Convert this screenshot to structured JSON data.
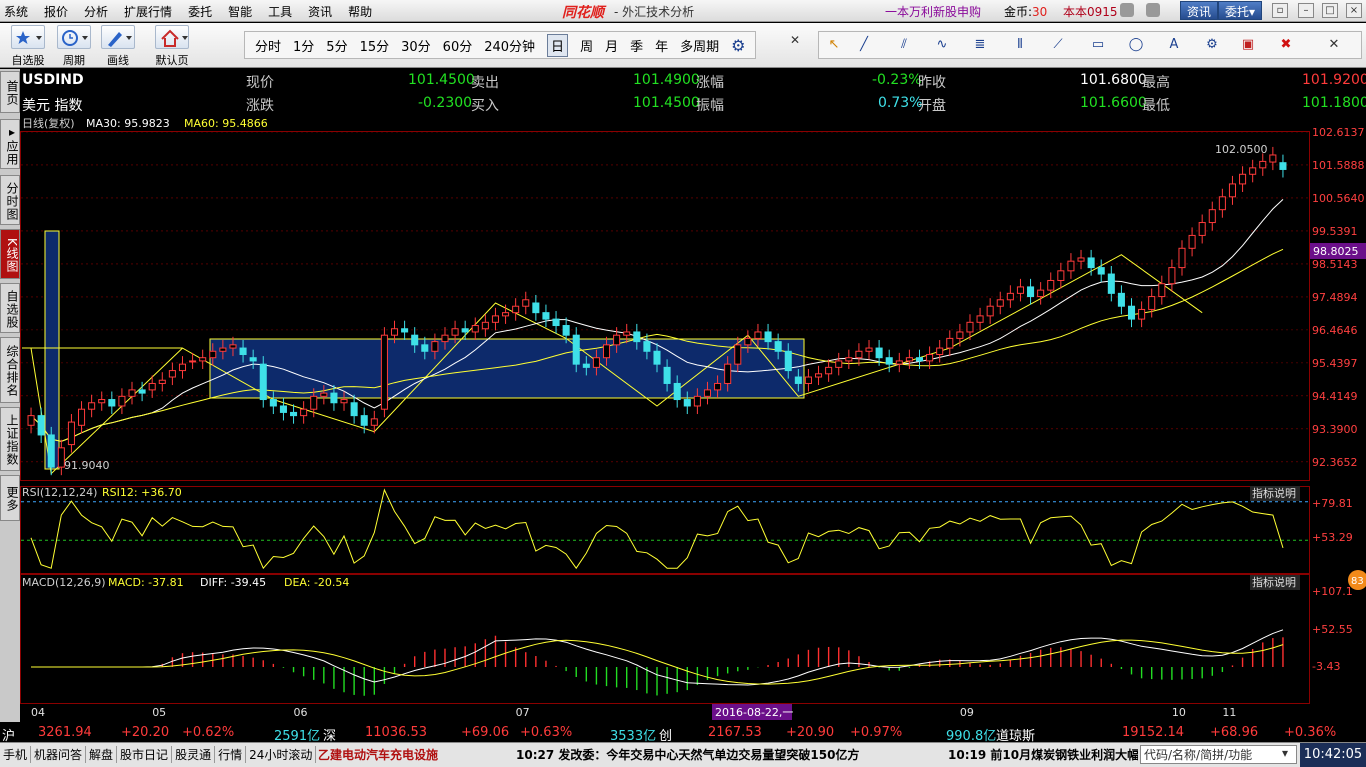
{
  "menu": {
    "items": [
      "系统",
      "报价",
      "分析",
      "扩展行情",
      "委托",
      "智能",
      "工具",
      "资讯",
      "帮助"
    ],
    "logo": "同花顺",
    "app_title": "- 外汇技术分析",
    "promo": "一本万利新股申购",
    "coins_label": "金币:",
    "coins_value": "30",
    "user": "本本0915",
    "info_button": "资讯",
    "trade_button": "委托▾"
  },
  "toolbar": {
    "groups": [
      {
        "label": "自选股",
        "icon": "star-icon"
      },
      {
        "label": "周期",
        "icon": "clock-icon"
      },
      {
        "label": "画线",
        "icon": "pen-icon"
      },
      {
        "label": "默认页",
        "icon": "home-icon"
      }
    ],
    "periods": [
      "分时",
      "1分",
      "5分",
      "15分",
      "30分",
      "60分",
      "240分钟",
      "日",
      "周",
      "月",
      "季",
      "年",
      "多周期"
    ],
    "active_period": "日"
  },
  "sidetabs": [
    {
      "label": "首页",
      "active": false
    },
    {
      "label": "▸应用",
      "active": false
    },
    {
      "label": "分时图",
      "active": false
    },
    {
      "label": "K线图",
      "active": true
    },
    {
      "label": "自选股",
      "active": false
    },
    {
      "label": "综合排名",
      "active": false
    },
    {
      "label": "上证指数",
      "active": false
    },
    {
      "label": "更多",
      "active": false
    }
  ],
  "quote": {
    "symbol": "USDIND",
    "name": "美元 指数",
    "now_label": "现价",
    "now_value": "101.4500",
    "sell_label": "卖出",
    "sell_value": "101.4900",
    "chg_pct_label": "涨幅",
    "chg_pct_value": "-0.23%",
    "prev_label": "昨收",
    "prev_value": "101.6800",
    "high_label": "最高",
    "high_value": "101.9200",
    "chg_label": "涨跌",
    "chg_value": "-0.2300",
    "buy_label": "买入",
    "buy_value": "101.4500",
    "amp_label": "振幅",
    "amp_value": "0.73%",
    "open_label": "开盘",
    "open_value": "101.6600",
    "low_label": "最低",
    "low_value": "101.1800"
  },
  "chart_data": [
    {
      "type": "candlestick",
      "legend": {
        "period": "日线(复权)",
        "ma30": "MA30: 95.9823",
        "ma60": "MA60: 95.4866"
      },
      "y_ticks": [
        "102.6137",
        "101.5888",
        "100.5640",
        "99.5391",
        "98.5143",
        "97.4894",
        "96.4646",
        "95.4397",
        "94.4149",
        "93.3900",
        "92.3652"
      ],
      "ylim": [
        91.8,
        102.6137
      ],
      "current_price_tag": "98.8025",
      "annotations": {
        "high": "102.0500",
        "low": "91.9040"
      },
      "x_labels": [
        "04",
        "05",
        "06",
        "07",
        "08",
        "09",
        "10",
        "11"
      ],
      "cursor_date": "2016-08-22,一",
      "closes": [
        93.8,
        93.2,
        92.2,
        92.8,
        93.6,
        94.0,
        94.2,
        94.3,
        94.1,
        94.4,
        94.6,
        94.5,
        94.8,
        94.9,
        95.2,
        95.4,
        95.5,
        95.6,
        95.8,
        95.9,
        96.0,
        95.7,
        95.5,
        94.3,
        94.1,
        93.9,
        93.8,
        94.0,
        94.4,
        94.5,
        94.2,
        94.3,
        93.8,
        93.5,
        93.7,
        96.3,
        96.5,
        96.4,
        96.0,
        95.8,
        96.1,
        96.3,
        96.5,
        96.4,
        96.6,
        96.7,
        96.9,
        97.0,
        97.2,
        97.4,
        97.0,
        96.8,
        96.6,
        96.3,
        95.4,
        95.3,
        95.6,
        96.0,
        96.3,
        96.4,
        96.1,
        95.8,
        95.4,
        94.8,
        94.3,
        94.1,
        94.4,
        94.6,
        94.8,
        95.4,
        96.0,
        96.2,
        96.4,
        96.1,
        95.8,
        95.2,
        94.8,
        95.0,
        95.1,
        95.3,
        95.5,
        95.6,
        95.8,
        95.9,
        95.6,
        95.4,
        95.5,
        95.6,
        95.5,
        95.7,
        95.9,
        96.2,
        96.4,
        96.7,
        96.9,
        97.2,
        97.4,
        97.6,
        97.8,
        97.5,
        97.7,
        98.0,
        98.3,
        98.6,
        98.7,
        98.4,
        98.2,
        97.6,
        97.2,
        96.8,
        97.1,
        97.5,
        97.9,
        98.4,
        99.0,
        99.4,
        99.8,
        100.2,
        100.6,
        101.0,
        101.3,
        101.5,
        101.7,
        101.9,
        101.45
      ],
      "opens": [
        93.5,
        93.8,
        93.2,
        92.2,
        92.9,
        93.5,
        94.0,
        94.2,
        94.3,
        94.1,
        94.4,
        94.6,
        94.6,
        94.8,
        95.0,
        95.2,
        95.5,
        95.5,
        95.6,
        95.8,
        95.9,
        95.9,
        95.6,
        95.4,
        94.3,
        94.1,
        93.9,
        93.8,
        94.0,
        94.4,
        94.5,
        94.2,
        94.2,
        93.8,
        93.5,
        94.0,
        96.3,
        96.5,
        96.3,
        96.0,
        95.8,
        96.1,
        96.3,
        96.5,
        96.4,
        96.5,
        96.7,
        96.9,
        97.0,
        97.2,
        97.3,
        97.0,
        96.8,
        96.6,
        96.3,
        95.4,
        95.3,
        95.6,
        96.0,
        96.3,
        96.4,
        96.1,
        95.8,
        95.3,
        94.8,
        94.3,
        94.1,
        94.4,
        94.6,
        94.8,
        95.4,
        96.0,
        96.2,
        96.4,
        96.1,
        95.8,
        95.0,
        94.8,
        95.0,
        95.1,
        95.3,
        95.5,
        95.6,
        95.8,
        95.9,
        95.6,
        95.4,
        95.5,
        95.6,
        95.5,
        95.7,
        95.9,
        96.2,
        96.4,
        96.7,
        96.9,
        97.2,
        97.4,
        97.6,
        97.8,
        97.5,
        97.7,
        98.0,
        98.3,
        98.6,
        98.7,
        98.4,
        98.2,
        97.6,
        97.2,
        96.8,
        97.1,
        97.5,
        97.9,
        98.4,
        99.0,
        99.4,
        99.8,
        100.2,
        100.6,
        101.0,
        101.3,
        101.5,
        101.68,
        101.66
      ]
    },
    {
      "type": "line",
      "legend": {
        "name": "RSI(12,12,24)",
        "value": "RSI12: +36.70"
      },
      "indicator_button": "指标说明",
      "y_ticks": [
        "+79.81",
        "+53.29"
      ],
      "ylim": [
        30,
        90
      ]
    },
    {
      "type": "bar",
      "legend": {
        "name": "MACD(12,26,9)",
        "macd": "MACD: -37.81",
        "diff": "DIFF: -39.45",
        "dea": "DEA: -20.54"
      },
      "indicator_button": "指标说明",
      "y_ticks": [
        "+107.1",
        "+52.55",
        "-3.43"
      ],
      "ylim": [
        -60,
        120
      ],
      "badge": "83"
    }
  ],
  "ticker": {
    "sh_label": "沪",
    "sh_value": "3261.94",
    "sh_chg": "+20.20",
    "sh_pct": "+0.62%",
    "sh_amt": "2591亿",
    "sz_label": "深",
    "sz_value": "11036.53",
    "sz_chg": "+69.06",
    "sz_pct": "+0.63%",
    "sz_amt": "3533亿",
    "cy_label": "创",
    "cy_value": "2167.53",
    "cy_chg": "+20.90",
    "cy_pct": "+0.97%",
    "cy_amt": "990.8亿",
    "dj_label": "道琼斯",
    "dj_value": "19152.14",
    "dj_chg": "+68.96",
    "dj_pct": "+0.36%"
  },
  "status": {
    "tabs": [
      "手机",
      "机器问答",
      "解盘",
      "股市日记",
      "股灵通",
      "行情",
      "24小时滚动"
    ],
    "news1": "乙建电动汽车充电设施",
    "news2": "10:27 发改委：今年交易中心天然气单边交易量望突破150亿方",
    "news3": "10:19 前10月煤炭钢铁业利润大幅",
    "search_placeholder": "代码/名称/简拼/功能",
    "clock": "10:42:05"
  },
  "colors": {
    "up": "#ff3b3b",
    "down": "#3fe0e8",
    "ma_white": "#ffffff",
    "ma_yellow": "#ffff33",
    "grid": "#8a0000"
  }
}
